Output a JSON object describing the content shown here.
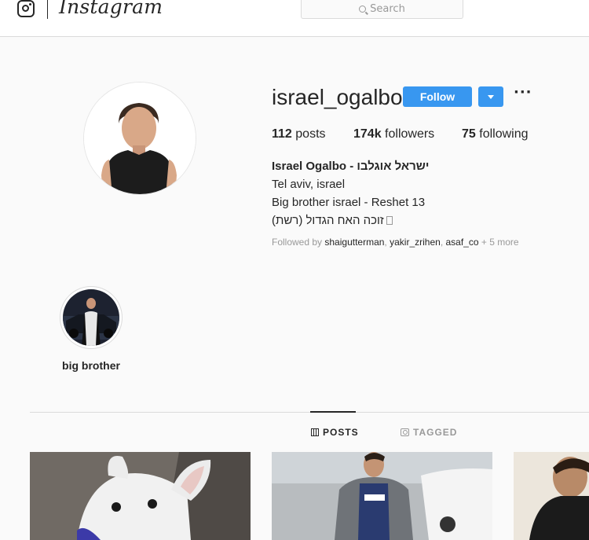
{
  "header": {
    "logo_icon": "instagram-camera-icon",
    "wordmark": "Instagram",
    "search": {
      "placeholder": "Search",
      "icon": "search-icon"
    }
  },
  "profile": {
    "username": "israel_ogalbo",
    "follow_label": "Follow",
    "dropdown_icon": "caret-down-icon",
    "more_label": "···",
    "stats": {
      "posts_count": "112",
      "posts_label": "posts",
      "followers_count": "174k",
      "followers_label": "followers",
      "following_count": "75",
      "following_label": "following"
    },
    "bio": {
      "full_name": "Israel Ogalbo - ישראל אוגלבו",
      "line1": "Tel aviv, israel",
      "line2": "Big brother israel - Reshet 13",
      "line3": "זוכה האח הגדול (רשת)"
    },
    "followed_by": {
      "prefix": "Followed by",
      "users": [
        "shaigutterman",
        "yakir_zrihen",
        "asaf_co"
      ],
      "separator": ",",
      "more": "+ 5 more"
    }
  },
  "highlights": [
    {
      "label": "big brother"
    }
  ],
  "tabs": [
    {
      "label": "POSTS",
      "icon": "grid-icon",
      "active": true
    },
    {
      "label": "TAGGED",
      "icon": "tagged-icon",
      "active": false
    }
  ],
  "colors": {
    "accent": "#3897f0",
    "text": "#262626",
    "muted": "#999999",
    "border": "#dbdbdb",
    "background": "#fafafa"
  }
}
